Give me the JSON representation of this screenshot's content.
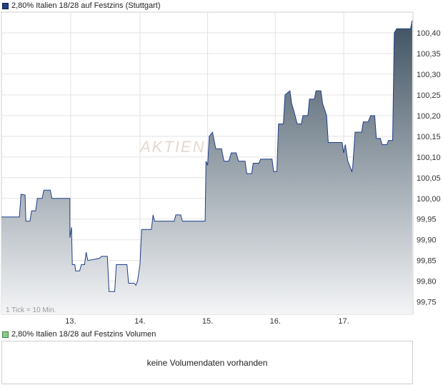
{
  "chart_data": {
    "type": "area",
    "title": "2,80% Italien 18/28 auf Festzins (Stuttgart)",
    "series_color": "#1f3f8a",
    "fill_top": "#3f5261",
    "fill_bottom": "#f4f5f7",
    "ylim": [
      99.72,
      100.45
    ],
    "yticks": [
      "99,75",
      "99,80",
      "99,85",
      "99,90",
      "99,95",
      "100,00",
      "100,05",
      "100,10",
      "100,15",
      "100,20",
      "100,25",
      "100,30",
      "100,35",
      "100,40"
    ],
    "day_labels": [
      "13.",
      "14.",
      "15.",
      "16.",
      "17."
    ],
    "grid": true,
    "note": "1 Tick = 10 Min.",
    "watermark": "AKTIEN",
    "points": [
      [
        0,
        99.955
      ],
      [
        2.2,
        99.955
      ],
      [
        2.4,
        100.01
      ],
      [
        2.9,
        100.008
      ],
      [
        3.0,
        99.945
      ],
      [
        3.5,
        99.945
      ],
      [
        3.7,
        99.97
      ],
      [
        4.2,
        99.97
      ],
      [
        4.4,
        100.0
      ],
      [
        5.0,
        100.0
      ],
      [
        5.2,
        100.02
      ],
      [
        6.0,
        100.02
      ],
      [
        6.2,
        100.0
      ],
      [
        8.4,
        100.0
      ],
      [
        8.4,
        99.905
      ],
      [
        8.6,
        99.93
      ],
      [
        8.7,
        99.84
      ],
      [
        9.0,
        99.84
      ],
      [
        9.1,
        99.825
      ],
      [
        9.6,
        99.825
      ],
      [
        9.8,
        99.84
      ],
      [
        10.2,
        99.84
      ],
      [
        10.4,
        99.87
      ],
      [
        10.6,
        99.85
      ],
      [
        12.0,
        99.855
      ],
      [
        12.3,
        99.86
      ],
      [
        13.0,
        99.86
      ],
      [
        13.2,
        99.775
      ],
      [
        13.9,
        99.775
      ],
      [
        14.1,
        99.84
      ],
      [
        15.4,
        99.84
      ],
      [
        15.6,
        99.795
      ],
      [
        16.3,
        99.795
      ],
      [
        16.5,
        99.79
      ],
      [
        16.7,
        99.8
      ],
      [
        17.0,
        99.84
      ],
      [
        17.2,
        99.925
      ],
      [
        18.4,
        99.925
      ],
      [
        18.6,
        99.96
      ],
      [
        18.8,
        99.945
      ],
      [
        21.2,
        99.945
      ],
      [
        21.4,
        99.96
      ],
      [
        22.0,
        99.96
      ],
      [
        22.2,
        99.945
      ],
      [
        25.0,
        99.945
      ],
      [
        25.1,
        100.09
      ],
      [
        25.3,
        100.08
      ],
      [
        25.5,
        100.15
      ],
      [
        25.9,
        100.16
      ],
      [
        26.3,
        100.12
      ],
      [
        27.0,
        100.12
      ],
      [
        27.3,
        100.09
      ],
      [
        27.9,
        100.09
      ],
      [
        28.2,
        100.11
      ],
      [
        28.8,
        100.11
      ],
      [
        29.1,
        100.09
      ],
      [
        29.9,
        100.09
      ],
      [
        30.1,
        100.06
      ],
      [
        30.7,
        100.06
      ],
      [
        30.9,
        100.085
      ],
      [
        31.6,
        100.085
      ],
      [
        31.8,
        100.095
      ],
      [
        33.2,
        100.095
      ],
      [
        33.4,
        100.065
      ],
      [
        33.8,
        100.065
      ],
      [
        34.0,
        100.18
      ],
      [
        34.6,
        100.18
      ],
      [
        34.8,
        100.25
      ],
      [
        35.4,
        100.26
      ],
      [
        35.6,
        100.23
      ],
      [
        35.9,
        100.21
      ],
      [
        36.3,
        100.18
      ],
      [
        36.8,
        100.18
      ],
      [
        37.0,
        100.2
      ],
      [
        37.6,
        100.2
      ],
      [
        37.8,
        100.24
      ],
      [
        38.4,
        100.24
      ],
      [
        38.6,
        100.26
      ],
      [
        39.2,
        100.26
      ],
      [
        39.4,
        100.23
      ],
      [
        39.9,
        100.2
      ],
      [
        40.1,
        100.135
      ],
      [
        41.8,
        100.135
      ],
      [
        42.0,
        100.11
      ],
      [
        42.2,
        100.13
      ],
      [
        42.5,
        100.09
      ],
      [
        43.0,
        100.065
      ],
      [
        43.1,
        100.075
      ],
      [
        43.4,
        100.16
      ],
      [
        44.0,
        100.16
      ],
      [
        44.2,
        100.16
      ],
      [
        44.4,
        100.185
      ],
      [
        45.0,
        100.185
      ],
      [
        45.3,
        100.2
      ],
      [
        45.8,
        100.2
      ],
      [
        46.0,
        100.145
      ],
      [
        46.5,
        100.145
      ],
      [
        46.7,
        100.13
      ],
      [
        47.3,
        100.13
      ],
      [
        47.5,
        100.14
      ],
      [
        48.0,
        100.14
      ],
      [
        48.2,
        100.4
      ],
      [
        48.5,
        100.41
      ],
      [
        50.2,
        100.41
      ],
      [
        50.4,
        100.43
      ]
    ],
    "x_max": 50.5,
    "day_x": [
      8.5,
      17.0,
      25.3,
      33.6,
      42.0
    ]
  },
  "volume": {
    "legend": "2,80% Italien 18/28 auf Festzins Volumen",
    "legend_color": "#88cc88",
    "message": "keine Volumendaten vorhanden"
  }
}
